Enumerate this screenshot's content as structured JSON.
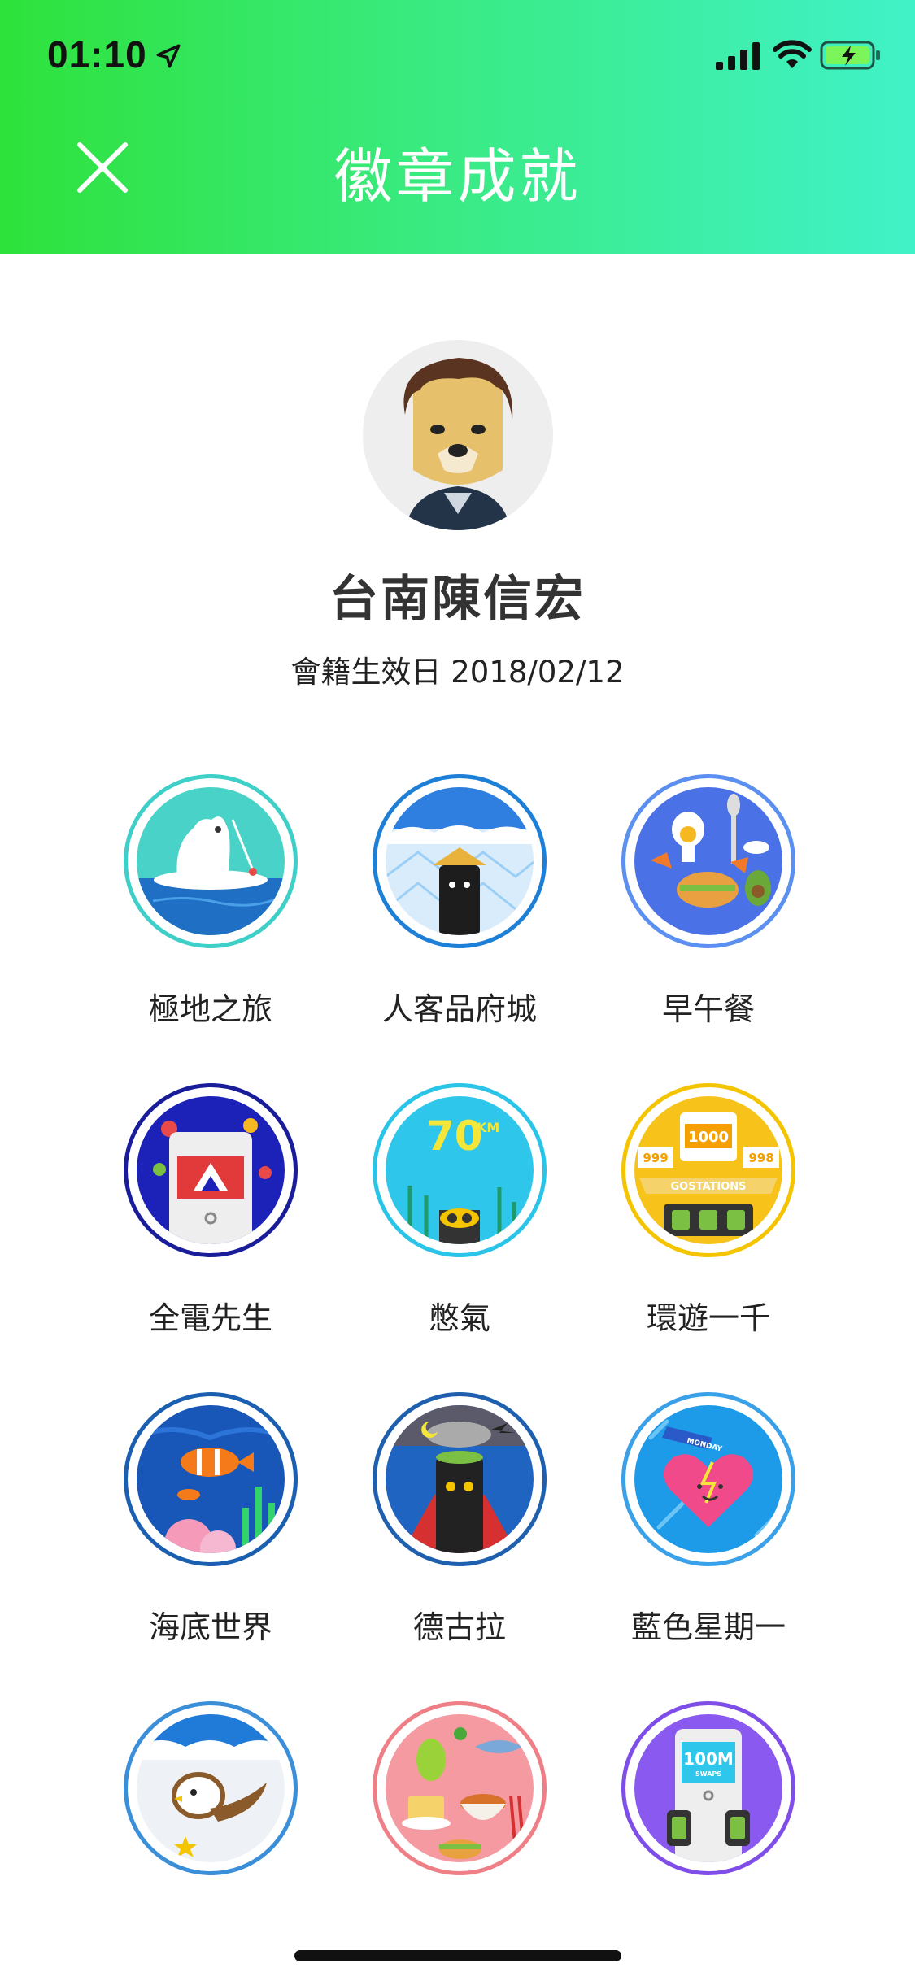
{
  "status_bar": {
    "time": "01:10"
  },
  "header": {
    "title": "徽章成就"
  },
  "profile": {
    "name": "台南陳信宏",
    "member_since": "會籍生效日 2018/02/12"
  },
  "badges": [
    {
      "label": "極地之旅",
      "ring_color": "#3ecfc8"
    },
    {
      "label": "人客品府城",
      "ring_color": "#1e7fd6"
    },
    {
      "label": "早午餐",
      "ring_color": "#5b8ff0"
    },
    {
      "label": "全電先生",
      "ring_color": "#1a1d9a"
    },
    {
      "label": "憋氣",
      "ring_color": "#29c4e8"
    },
    {
      "label": "環遊一千",
      "ring_color": "#f5c400"
    },
    {
      "label": "海底世界",
      "ring_color": "#1a5fb0"
    },
    {
      "label": "德古拉",
      "ring_color": "#1e5fae"
    },
    {
      "label": "藍色星期一",
      "ring_color": "#3aa0e8"
    },
    {
      "label": "",
      "ring_color": "#3b8fd8"
    },
    {
      "label": "",
      "ring_color": "#ef7f86"
    },
    {
      "label": "",
      "ring_color": "#7f4ee8"
    }
  ],
  "badge_art": {
    "b3_text": "1000",
    "b3_left": "999",
    "b3_right": "998",
    "b3_banner": "GOSTATIONS",
    "b4_text": "70",
    "b4_unit": "KM",
    "b8_banner": "MONDAY",
    "b11_text": "100M",
    "b11_sub": "SWAPS"
  },
  "colors": {
    "header_start": "#2ee23b",
    "header_end": "#40f2c8"
  }
}
